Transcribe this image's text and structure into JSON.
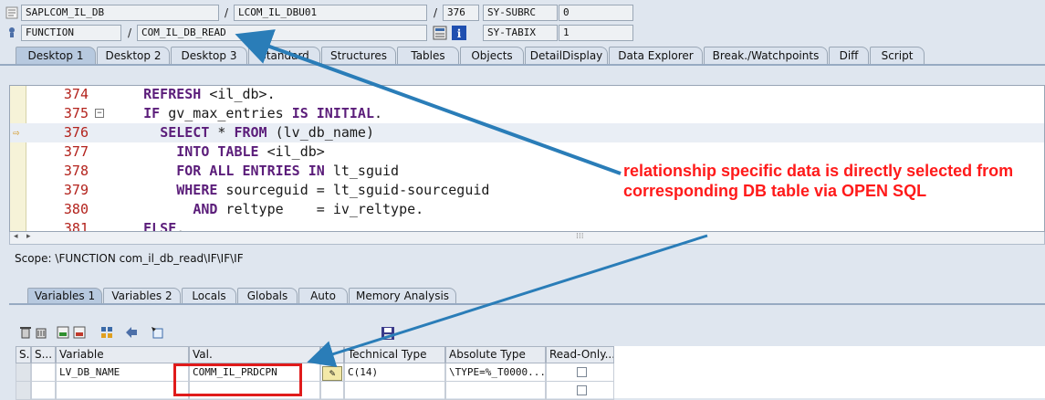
{
  "header": {
    "program": "SAPLCOM_IL_DB",
    "include": "LCOM_IL_DBU01",
    "line": "376",
    "field1_name": "SY-SUBRC",
    "field1_value": "0",
    "type": "FUNCTION",
    "function_name": "COM_IL_DB_READ",
    "field2_name": "SY-TABIX",
    "field2_value": "1",
    "separator": "/"
  },
  "tabs": [
    "Desktop 1",
    "Desktop 2",
    "Desktop 3",
    "Standard",
    "Structures",
    "Tables",
    "Objects",
    "DetailDisplay",
    "Data Explorer",
    "Break./Watchpoints",
    "Diff",
    "Script"
  ],
  "code_lines": [
    {
      "num": "374",
      "parts": [
        {
          "t": "    "
        },
        {
          "t": "REFRESH",
          "k": true
        },
        {
          "t": " <il_db>."
        }
      ]
    },
    {
      "num": "375",
      "parts": [
        {
          "t": "    "
        },
        {
          "t": "IF",
          "k": true
        },
        {
          "t": " gv_max_entries "
        },
        {
          "t": "IS INITIAL",
          "k": true
        },
        {
          "t": "."
        }
      ]
    },
    {
      "num": "376",
      "parts": [
        {
          "t": "      "
        },
        {
          "t": "SELECT",
          "k": true
        },
        {
          "t": " * "
        },
        {
          "t": "FROM",
          "k": true
        },
        {
          "t": " (lv_db_name)"
        }
      ]
    },
    {
      "num": "377",
      "parts": [
        {
          "t": "        "
        },
        {
          "t": "INTO TABLE",
          "k": true
        },
        {
          "t": " <il_db>"
        }
      ]
    },
    {
      "num": "378",
      "parts": [
        {
          "t": "        "
        },
        {
          "t": "FOR ALL ENTRIES IN",
          "k": true
        },
        {
          "t": " lt_sguid"
        }
      ]
    },
    {
      "num": "379",
      "parts": [
        {
          "t": "        "
        },
        {
          "t": "WHERE",
          "k": true
        },
        {
          "t": " sourceguid = lt_sguid-sourceguid"
        }
      ]
    },
    {
      "num": "380",
      "parts": [
        {
          "t": "          "
        },
        {
          "t": "AND",
          "k": true
        },
        {
          "t": " reltype    = iv_reltype."
        }
      ]
    },
    {
      "num": "381",
      "parts": [
        {
          "t": "    "
        },
        {
          "t": "ELSE",
          "k": true
        },
        {
          "t": "."
        }
      ]
    }
  ],
  "scope": "Scope: \\FUNCTION com_il_db_read\\IF\\IF\\IF",
  "lower_tabs": [
    "Variables 1",
    "Variables 2",
    "Locals",
    "Globals",
    "Auto",
    "Memory Analysis"
  ],
  "table": {
    "headers": [
      "S...",
      "Variable",
      "Val.",
      "...",
      "Technical Type",
      "Absolute Type",
      "Read-Only..."
    ],
    "row": {
      "variable": "LV_DB_NAME",
      "value": "COMM_IL_PRDCPN",
      "technical_type": "C(14)",
      "absolute_type": "\\TYPE=%_T0000..."
    }
  },
  "annotation": "relationship specific data is directly selected from corresponding DB table via OPEN SQL",
  "colors": {
    "annotation": "#ff1a1a",
    "arrow": "#2a7db8",
    "redbox": "#e01b1b"
  }
}
